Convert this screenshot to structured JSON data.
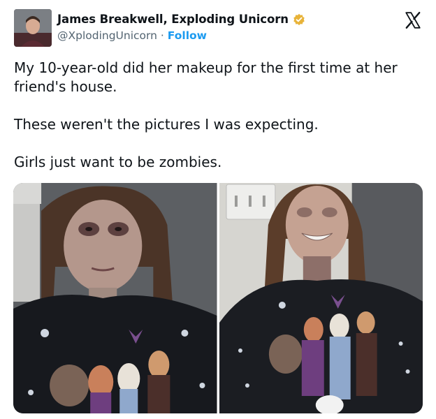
{
  "author": {
    "name": "James Breakwell, Exploding Unicorn",
    "handle": "@XplodingUnicorn",
    "separator": "·",
    "follow_label": "Follow",
    "verified": true
  },
  "icons": {
    "verified": "verified-badge-icon",
    "brand": "x-logo-icon"
  },
  "tweet": {
    "paragraphs": [
      "My 10-year-old did her makeup for the first time at her friend's house.",
      "These weren't the pictures I was expecting.",
      "Girls just want to be zombies."
    ]
  },
  "media": {
    "count": 2
  },
  "colors": {
    "link": "#1d9bf0",
    "verified_badge": "#e8b339",
    "secondary_text": "#536471"
  }
}
